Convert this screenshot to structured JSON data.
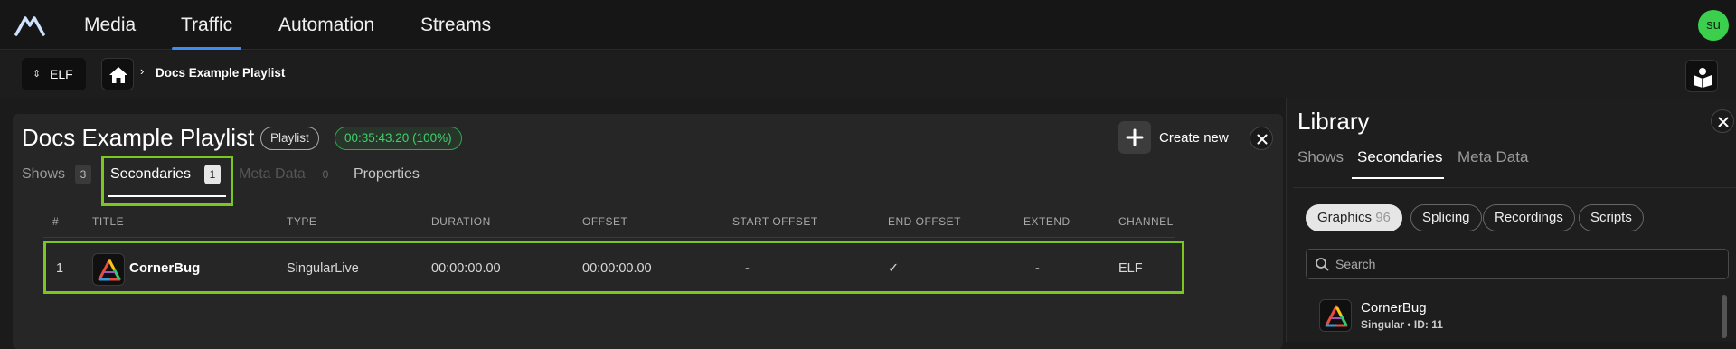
{
  "nav": {
    "tabs": [
      {
        "label": "Media"
      },
      {
        "label": "Traffic"
      },
      {
        "label": "Automation"
      },
      {
        "label": "Streams"
      }
    ],
    "active_tab": "Traffic",
    "avatar": "su"
  },
  "subbar": {
    "channel": "ELF",
    "breadcrumb": "Docs Example Playlist"
  },
  "playlist": {
    "title": "Docs Example Playlist",
    "type_badge": "Playlist",
    "duration_badge": "00:35:43.20 (100%)",
    "create_label": "Create new",
    "tabs": [
      {
        "label": "Shows",
        "count": "3"
      },
      {
        "label": "Secondaries",
        "count": "1"
      },
      {
        "label": "Meta Data",
        "count": "0"
      },
      {
        "label": "Properties"
      }
    ],
    "columns": [
      "#",
      "TITLE",
      "TYPE",
      "DURATION",
      "OFFSET",
      "START OFFSET",
      "END OFFSET",
      "EXTEND",
      "CHANNEL"
    ],
    "rows": [
      {
        "num": "1",
        "title": "CornerBug",
        "type": "SingularLive",
        "duration": "00:00:00.00",
        "offset": "00:00:00.00",
        "start_offset": "-",
        "end_offset": "✓",
        "extend": "-",
        "channel": "ELF"
      }
    ]
  },
  "library": {
    "title": "Library",
    "tabs": [
      {
        "label": "Shows"
      },
      {
        "label": "Secondaries"
      },
      {
        "label": "Meta Data"
      }
    ],
    "chips": [
      {
        "label": "Graphics",
        "count": "96"
      },
      {
        "label": "Splicing"
      },
      {
        "label": "Recordings"
      },
      {
        "label": "Scripts"
      }
    ],
    "search_placeholder": "Search",
    "items": [
      {
        "name": "CornerBug",
        "meta": "Singular • ID: 11"
      }
    ]
  },
  "colors": {
    "accent_blue": "#3d8cf0",
    "highlight_green": "#7ac81f",
    "duration_green": "#3fd16a",
    "avatar_green": "#3ccf4e"
  }
}
